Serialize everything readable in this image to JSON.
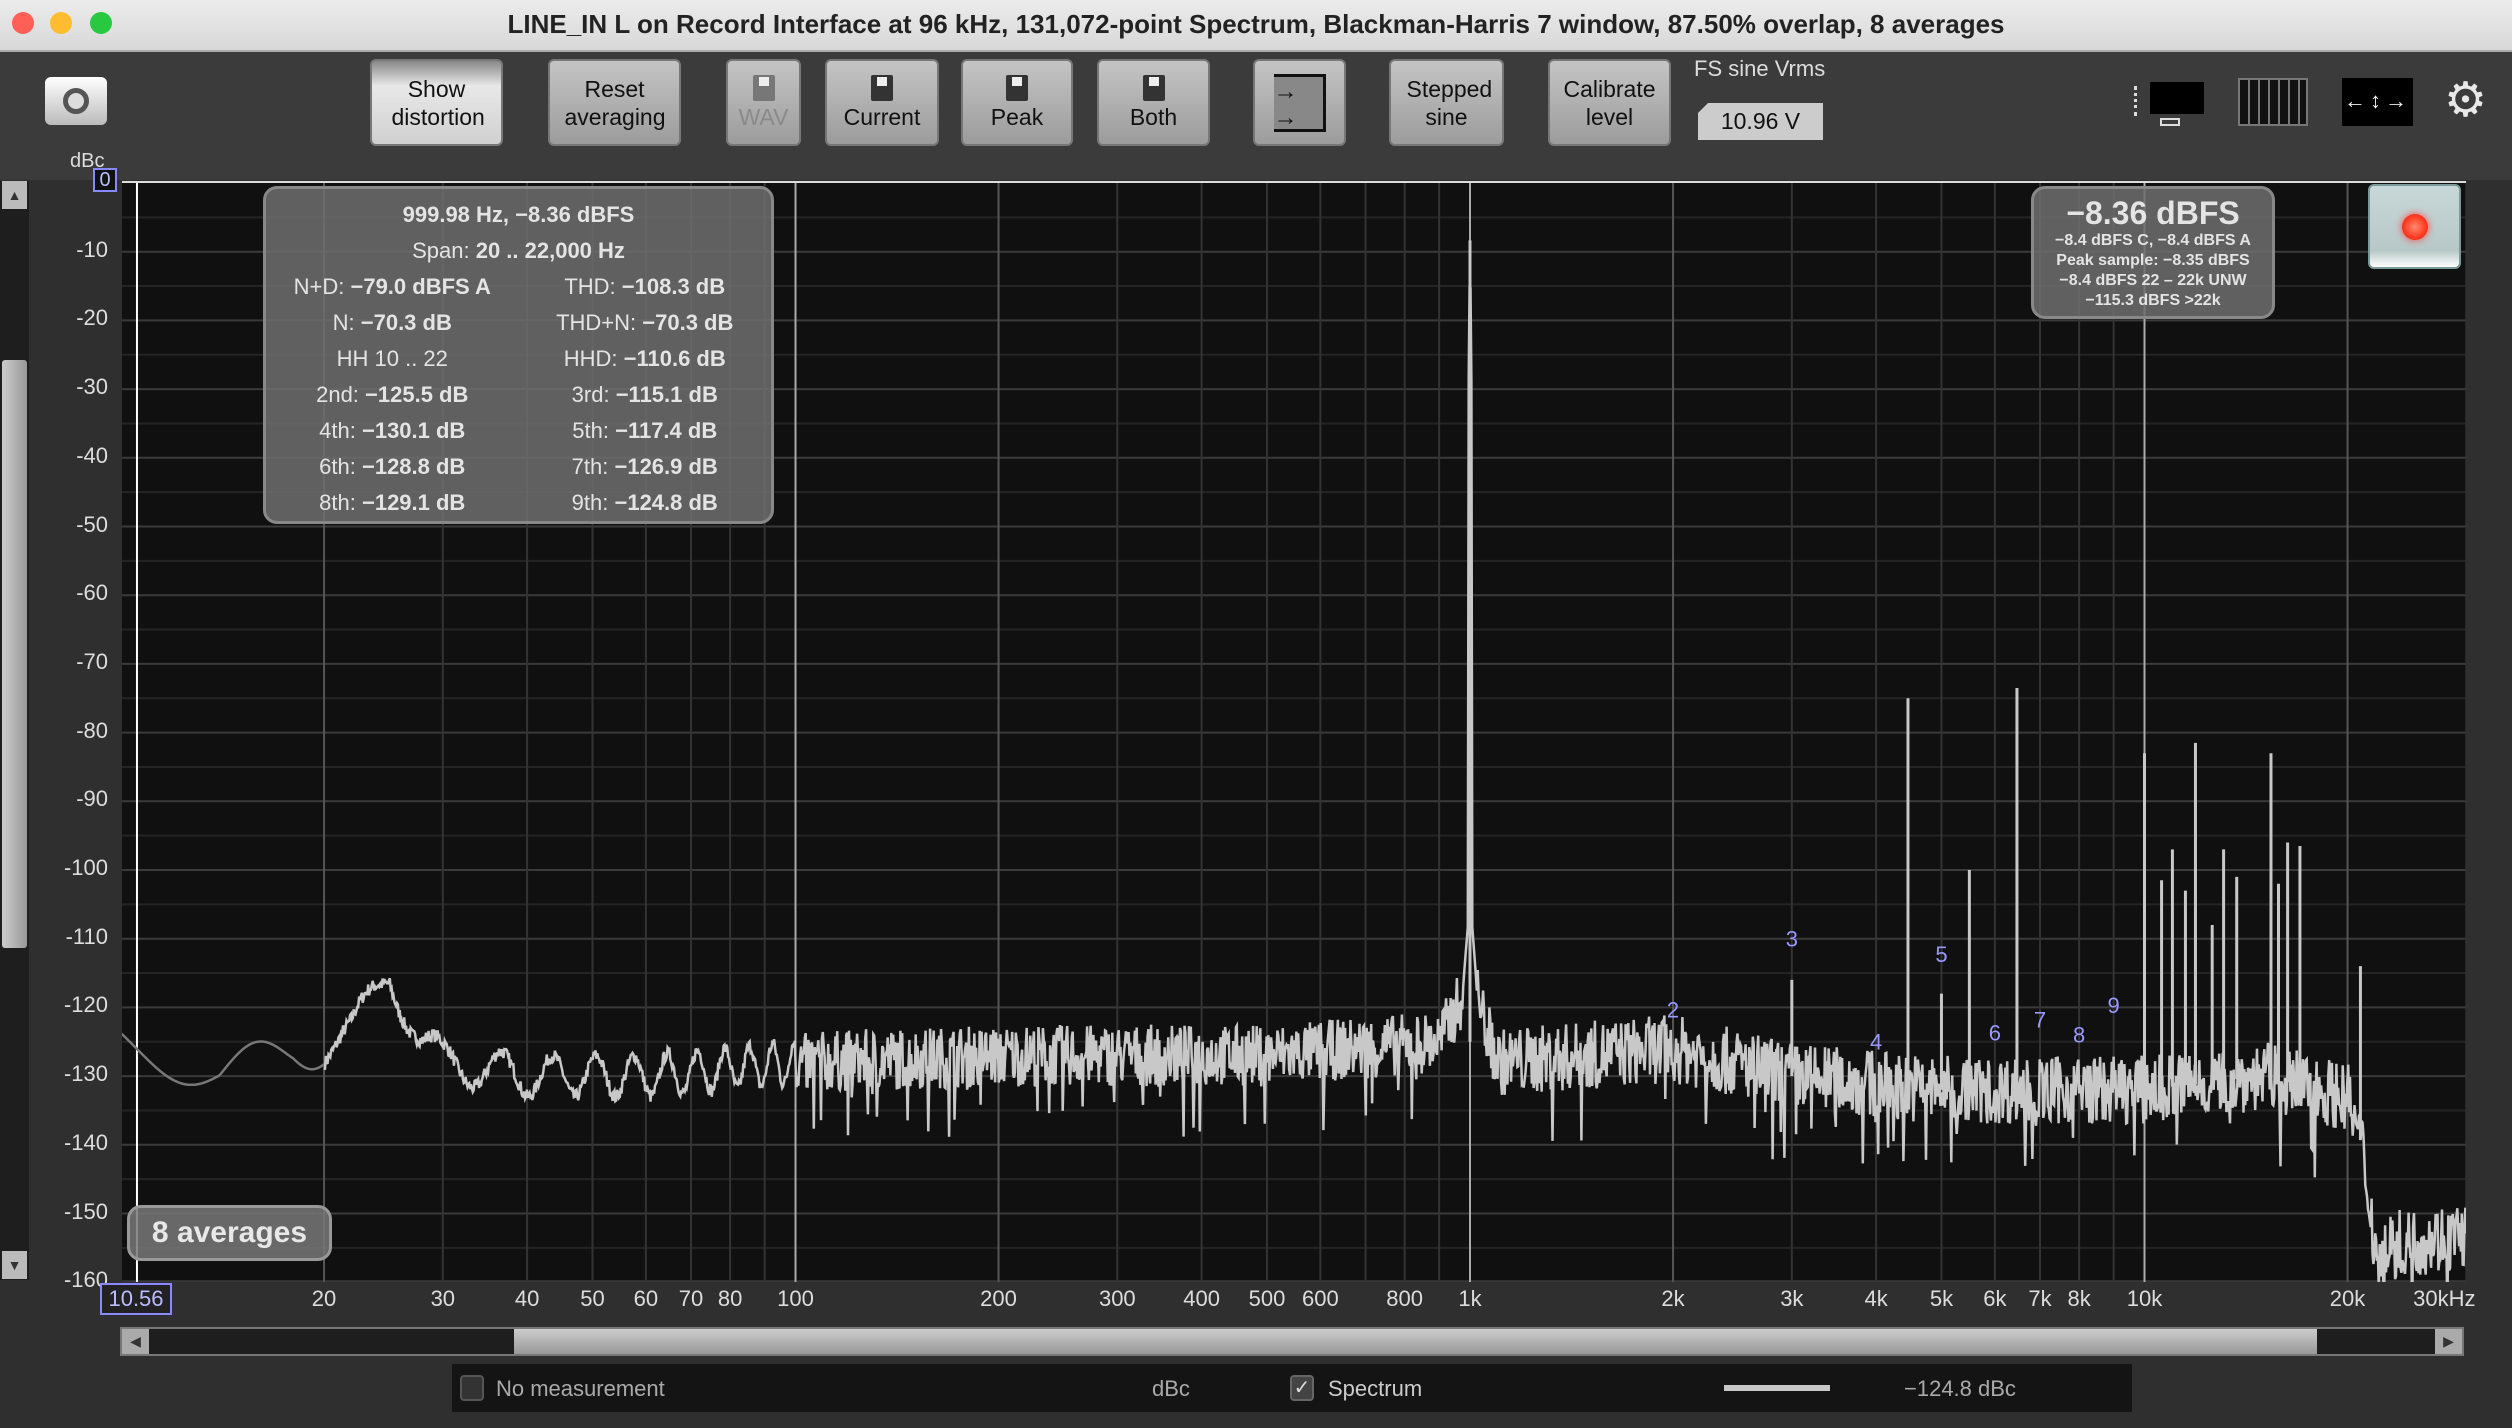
{
  "window": {
    "title": "LINE_IN L on Record Interface at 96 kHz, 131,072-point Spectrum, Blackman-Harris 7 window, 87.50% overlap, 8 averages"
  },
  "toolbar": {
    "show_distortion": "Show distortion",
    "reset_averaging": "Reset averaging",
    "wav": "WAV",
    "current": "Current",
    "peak": "Peak",
    "both": "Both",
    "stepped_sine": "Stepped sine",
    "calibrate_level": "Calibrate level",
    "fs_label": "FS sine Vrms",
    "fs_value": "10.96 V"
  },
  "stats_panel": {
    "header": "999.98 Hz, −8.36 dBFS",
    "span_label": "Span:",
    "span_value": "20 .. 22,000 Hz",
    "rows": [
      [
        {
          "k": "N+D:",
          "v": "−79.0 dBFS A"
        },
        {
          "k": "THD:",
          "v": "−108.3 dB"
        }
      ],
      [
        {
          "k": "N:",
          "v": "−70.3 dB"
        },
        {
          "k": "THD+N:",
          "v": "−70.3 dB"
        }
      ],
      [
        {
          "k": "HH 10 .. 22",
          "v": ""
        },
        {
          "k": "HHD:",
          "v": "−110.6 dB"
        }
      ],
      [
        {
          "k": "2nd:",
          "v": "−125.5 dB"
        },
        {
          "k": "3rd:",
          "v": "−115.1 dB"
        }
      ],
      [
        {
          "k": "4th:",
          "v": "−130.1 dB"
        },
        {
          "k": "5th:",
          "v": "−117.4 dB"
        }
      ],
      [
        {
          "k": "6th:",
          "v": "−128.8 dB"
        },
        {
          "k": "7th:",
          "v": "−126.9 dB"
        }
      ],
      [
        {
          "k": "8th:",
          "v": "−129.1 dB"
        },
        {
          "k": "9th:",
          "v": "−124.8 dB"
        }
      ]
    ]
  },
  "level_panel": {
    "main": "−8.36 dBFS",
    "lines": [
      "−8.4 dBFS C, −8.4 dBFS A",
      "Peak sample: −8.35 dBFS",
      "−8.4 dBFS 22 – 22k UNW",
      "−115.3 dBFS >22k"
    ]
  },
  "averages_badge": "8 averages",
  "legend": {
    "no_measurement": "No measurement",
    "unit": "dBc",
    "spectrum": "Spectrum",
    "spectrum_checked": true,
    "value": "−124.8 dBc"
  },
  "icons": [
    "camera-icon",
    "save-disk-icon",
    "export-icon",
    "layout-icon",
    "bars-icon",
    "fit-arrows-icon",
    "gear-icon",
    "record-icon"
  ],
  "colors": {
    "trace": "#c8c8c8",
    "harmonic_label": "#9999ff",
    "record": "#ff3a20",
    "plot_bg": "#101010"
  },
  "chart_data": {
    "type": "line",
    "ylabel": "dBc",
    "xunit": "kHz",
    "xscale": "log",
    "xlim": [
      10.56,
      30000
    ],
    "ylim": [
      -160,
      0
    ],
    "grid": true,
    "y_ticks": [
      "0",
      "-10",
      "-20",
      "-30",
      "-40",
      "-50",
      "-60",
      "-70",
      "-80",
      "-90",
      "-100",
      "-110",
      "-120",
      "-130",
      "-140",
      "-150",
      "-160"
    ],
    "x_cursor_label": "10.56",
    "x_ticks": [
      {
        "f": 20,
        "l": "20"
      },
      {
        "f": 30,
        "l": "30"
      },
      {
        "f": 40,
        "l": "40"
      },
      {
        "f": 50,
        "l": "50"
      },
      {
        "f": 60,
        "l": "60"
      },
      {
        "f": 70,
        "l": "70"
      },
      {
        "f": 80,
        "l": "80"
      },
      {
        "f": 100,
        "l": "100"
      },
      {
        "f": 200,
        "l": "200"
      },
      {
        "f": 300,
        "l": "300"
      },
      {
        "f": 400,
        "l": "400"
      },
      {
        "f": 500,
        "l": "500"
      },
      {
        "f": 600,
        "l": "600"
      },
      {
        "f": 800,
        "l": "800"
      },
      {
        "f": 1000,
        "l": "1k"
      },
      {
        "f": 2000,
        "l": "2k"
      },
      {
        "f": 3000,
        "l": "3k"
      },
      {
        "f": 4000,
        "l": "4k"
      },
      {
        "f": 5000,
        "l": "5k"
      },
      {
        "f": 6000,
        "l": "6k"
      },
      {
        "f": 7000,
        "l": "7k"
      },
      {
        "f": 8000,
        "l": "8k"
      },
      {
        "f": 10000,
        "l": "10k"
      },
      {
        "f": 20000,
        "l": "20k"
      },
      {
        "f": 30000,
        "l": "30kHz"
      }
    ],
    "fundamental": {
      "freq": 999.98,
      "level": -8.36
    },
    "noise_floor": [
      [
        10,
        -125
      ],
      [
        14,
        -130
      ],
      [
        18,
        -126
      ],
      [
        20,
        -126
      ],
      [
        22,
        -124
      ],
      [
        25,
        -115
      ],
      [
        28,
        -125
      ],
      [
        30,
        -128
      ],
      [
        40,
        -130
      ],
      [
        60,
        -130
      ],
      [
        100,
        -128
      ],
      [
        200,
        -127
      ],
      [
        500,
        -127
      ],
      [
        900,
        -125
      ],
      [
        980,
        -118
      ],
      [
        1020,
        -118
      ],
      [
        1100,
        -128
      ],
      [
        2000,
        -126
      ],
      [
        3000,
        -130
      ],
      [
        5000,
        -132
      ],
      [
        10000,
        -132
      ],
      [
        15000,
        -130
      ],
      [
        20000,
        -133
      ],
      [
        21000,
        -140
      ],
      [
        22000,
        -155
      ],
      [
        30000,
        -153
      ]
    ],
    "spurs": [
      [
        3000,
        -116
      ],
      [
        4460,
        -75
      ],
      [
        5000,
        -118
      ],
      [
        5500,
        -100
      ],
      [
        6470,
        -73.5
      ],
      [
        10000,
        -83
      ],
      [
        10600,
        -101.5
      ],
      [
        11000,
        -97
      ],
      [
        11500,
        -103
      ],
      [
        11900,
        -81.5
      ],
      [
        12600,
        -108
      ],
      [
        13100,
        -97
      ],
      [
        13700,
        -101
      ],
      [
        15400,
        -83
      ],
      [
        15800,
        -102
      ],
      [
        16300,
        -96
      ],
      [
        17000,
        -96.5
      ],
      [
        20900,
        -114
      ]
    ],
    "harmonics": [
      {
        "n": "2",
        "freq": 2000,
        "level": -125.5
      },
      {
        "n": "3",
        "freq": 3000,
        "level": -115.1
      },
      {
        "n": "4",
        "freq": 4000,
        "level": -130.1
      },
      {
        "n": "5",
        "freq": 5000,
        "level": -117.4
      },
      {
        "n": "6",
        "freq": 6000,
        "level": -128.8
      },
      {
        "n": "7",
        "freq": 7000,
        "level": -126.9
      },
      {
        "n": "8",
        "freq": 8000,
        "level": -129.1
      },
      {
        "n": "9",
        "freq": 9000,
        "level": -124.8
      }
    ]
  }
}
